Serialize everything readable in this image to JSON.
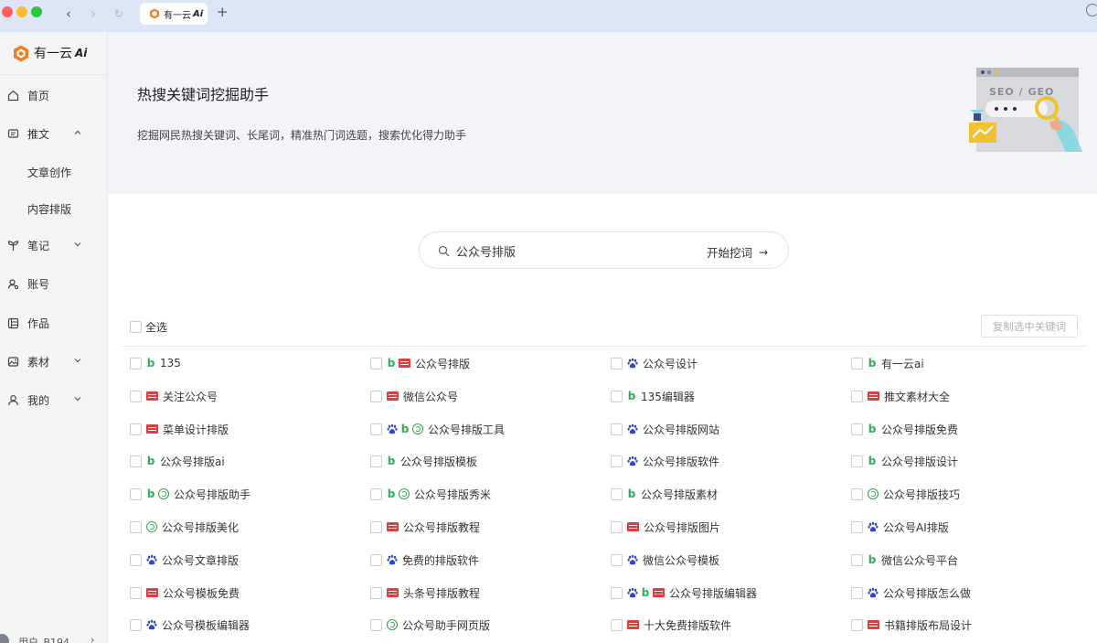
{
  "browser": {
    "tab_title": "有一云",
    "tab_title_ai": "Ai",
    "new_tab": "+"
  },
  "sidebar": {
    "logo_text": "有一云",
    "logo_ai": "Ai",
    "items": [
      {
        "label": "首页",
        "icon": "home-icon",
        "expanded": false
      },
      {
        "label": "推文",
        "icon": "article-icon",
        "expanded": true,
        "chevron": "chevron-up-icon"
      },
      {
        "label": "笔记",
        "icon": "sprout-icon",
        "chevron": "chevron-down-icon"
      },
      {
        "label": "账号",
        "icon": "account-icon"
      },
      {
        "label": "作品",
        "icon": "works-icon"
      },
      {
        "label": "素材",
        "icon": "material-icon",
        "chevron": "chevron-down-icon"
      },
      {
        "label": "我的",
        "icon": "user-icon",
        "chevron": "chevron-down-icon"
      }
    ],
    "sub_items": [
      "文章创作",
      "内容排版"
    ],
    "user": "用户_B194"
  },
  "banner": {
    "title": "热搜关键词挖掘助手",
    "subtitle": "挖掘网民热搜关键词、长尾词，精准热门词选题，搜索优化得力助手",
    "illustration_text": "SEO / GEO"
  },
  "search": {
    "value": "公众号排版",
    "button_label": "开始挖词",
    "button_arrow": "→"
  },
  "toolbar": {
    "select_all_label": "全选",
    "copy_label": "复制选中关键词"
  },
  "colors": {
    "bing": "#2eae5a",
    "toutiao": "#e13d3d",
    "baidu": "#2f46d0",
    "sogou": "#2fa54a",
    "accent": "#f47b20"
  },
  "keywords": [
    [
      {
        "text": "135",
        "sources": [
          "bing"
        ]
      },
      {
        "text": "关注公众号",
        "sources": [
          "toutiao"
        ]
      },
      {
        "text": "菜单设计排版",
        "sources": [
          "toutiao"
        ]
      },
      {
        "text": "公众号排版ai",
        "sources": [
          "bing"
        ]
      },
      {
        "text": "公众号排版助手",
        "sources": [
          "bing",
          "sogou"
        ]
      },
      {
        "text": "公众号排版美化",
        "sources": [
          "sogou"
        ]
      },
      {
        "text": "公众号文章排版",
        "sources": [
          "baidu"
        ]
      },
      {
        "text": "公众号模板免费",
        "sources": [
          "toutiao"
        ]
      },
      {
        "text": "公众号模板编辑器",
        "sources": [
          "baidu"
        ]
      }
    ],
    [
      {
        "text": "公众号排版",
        "sources": [
          "bing",
          "toutiao"
        ]
      },
      {
        "text": "微信公众号",
        "sources": [
          "toutiao"
        ]
      },
      {
        "text": "公众号排版工具",
        "sources": [
          "baidu",
          "bing",
          "sogou"
        ]
      },
      {
        "text": "公众号排版模板",
        "sources": [
          "bing"
        ]
      },
      {
        "text": "公众号排版秀米",
        "sources": [
          "bing",
          "sogou"
        ]
      },
      {
        "text": "公众号排版教程",
        "sources": [
          "toutiao"
        ]
      },
      {
        "text": "免费的排版软件",
        "sources": [
          "baidu"
        ]
      },
      {
        "text": "头条号排版教程",
        "sources": [
          "toutiao"
        ]
      },
      {
        "text": "公众号助手网页版",
        "sources": [
          "sogou"
        ]
      }
    ],
    [
      {
        "text": "公众号设计",
        "sources": [
          "baidu"
        ]
      },
      {
        "text": "135编辑器",
        "sources": [
          "bing"
        ]
      },
      {
        "text": "公众号排版网站",
        "sources": [
          "baidu"
        ]
      },
      {
        "text": "公众号排版软件",
        "sources": [
          "baidu"
        ]
      },
      {
        "text": "公众号排版素材",
        "sources": [
          "bing"
        ]
      },
      {
        "text": "公众号排版图片",
        "sources": [
          "toutiao"
        ]
      },
      {
        "text": "微信公众号模板",
        "sources": [
          "baidu"
        ]
      },
      {
        "text": "公众号排版编辑器",
        "sources": [
          "baidu",
          "bing",
          "toutiao"
        ]
      },
      {
        "text": "十大免费排版软件",
        "sources": [
          "toutiao"
        ]
      }
    ],
    [
      {
        "text": "有一云ai",
        "sources": [
          "bing"
        ]
      },
      {
        "text": "推文素材大全",
        "sources": [
          "toutiao"
        ]
      },
      {
        "text": "公众号排版免费",
        "sources": [
          "bing"
        ]
      },
      {
        "text": "公众号排版设计",
        "sources": [
          "bing"
        ]
      },
      {
        "text": "公众号排版技巧",
        "sources": [
          "sogou"
        ]
      },
      {
        "text": "公众号AI排版",
        "sources": [
          "baidu"
        ]
      },
      {
        "text": "微信公众号平台",
        "sources": [
          "bing"
        ]
      },
      {
        "text": "公众号排版怎么做",
        "sources": [
          "baidu"
        ]
      },
      {
        "text": "书籍排版布局设计",
        "sources": [
          "toutiao"
        ]
      }
    ]
  ]
}
